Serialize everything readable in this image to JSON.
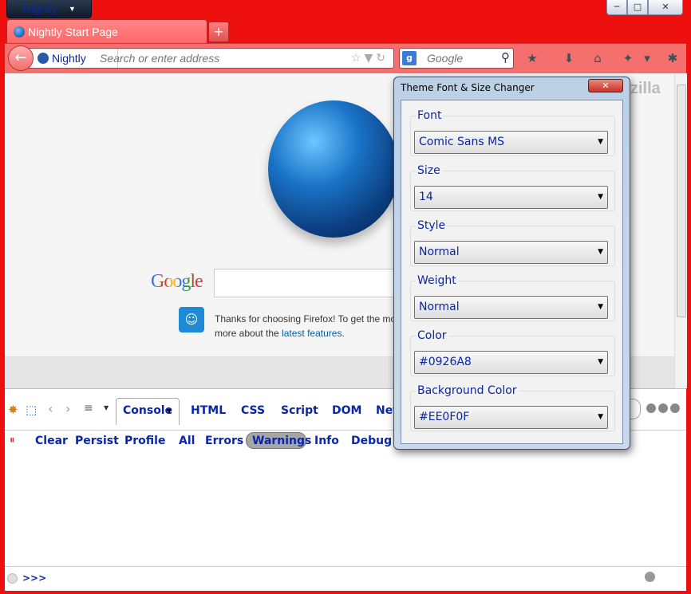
{
  "window": {
    "app_button": "Nightly",
    "caption_min": "─",
    "caption_max": "□",
    "caption_close": "✕"
  },
  "tabs": [
    {
      "label": "Nightly Start Page"
    }
  ],
  "new_tab": "+",
  "navbar": {
    "identity": "Nightly",
    "url_placeholder": "Search or enter address",
    "search_engine_badge": "g",
    "search_placeholder": "Google"
  },
  "content": {
    "mozilla_text": "zilla",
    "google_logo": "Google",
    "snippet_text": "Thanks for choosing Firefox! To get the mo",
    "snippet_text2": "more about the ",
    "snippet_link": "latest features",
    "snippet_end": "."
  },
  "firebug": {
    "tabs": [
      "Console",
      "HTML",
      "CSS",
      "Script",
      "DOM",
      "Net"
    ],
    "toolbar": [
      "Clear",
      "Persist",
      "Profile",
      "All",
      "Errors",
      "Warnings",
      "Info",
      "Debug I"
    ],
    "prompt": ">>>"
  },
  "dialog": {
    "title": "Theme Font & Size Changer",
    "close": "✕",
    "fields": [
      {
        "label": "Font",
        "value": "Comic Sans MS"
      },
      {
        "label": "Size",
        "value": "14"
      },
      {
        "label": "Style",
        "value": "Normal"
      },
      {
        "label": "Weight",
        "value": "Normal"
      },
      {
        "label": "Color",
        "value": "#0926A8"
      },
      {
        "label": "Background Color",
        "value": "#EE0F0F"
      }
    ]
  },
  "colors": {
    "accent_text": "#0926A8",
    "background": "#EE0F0F"
  }
}
